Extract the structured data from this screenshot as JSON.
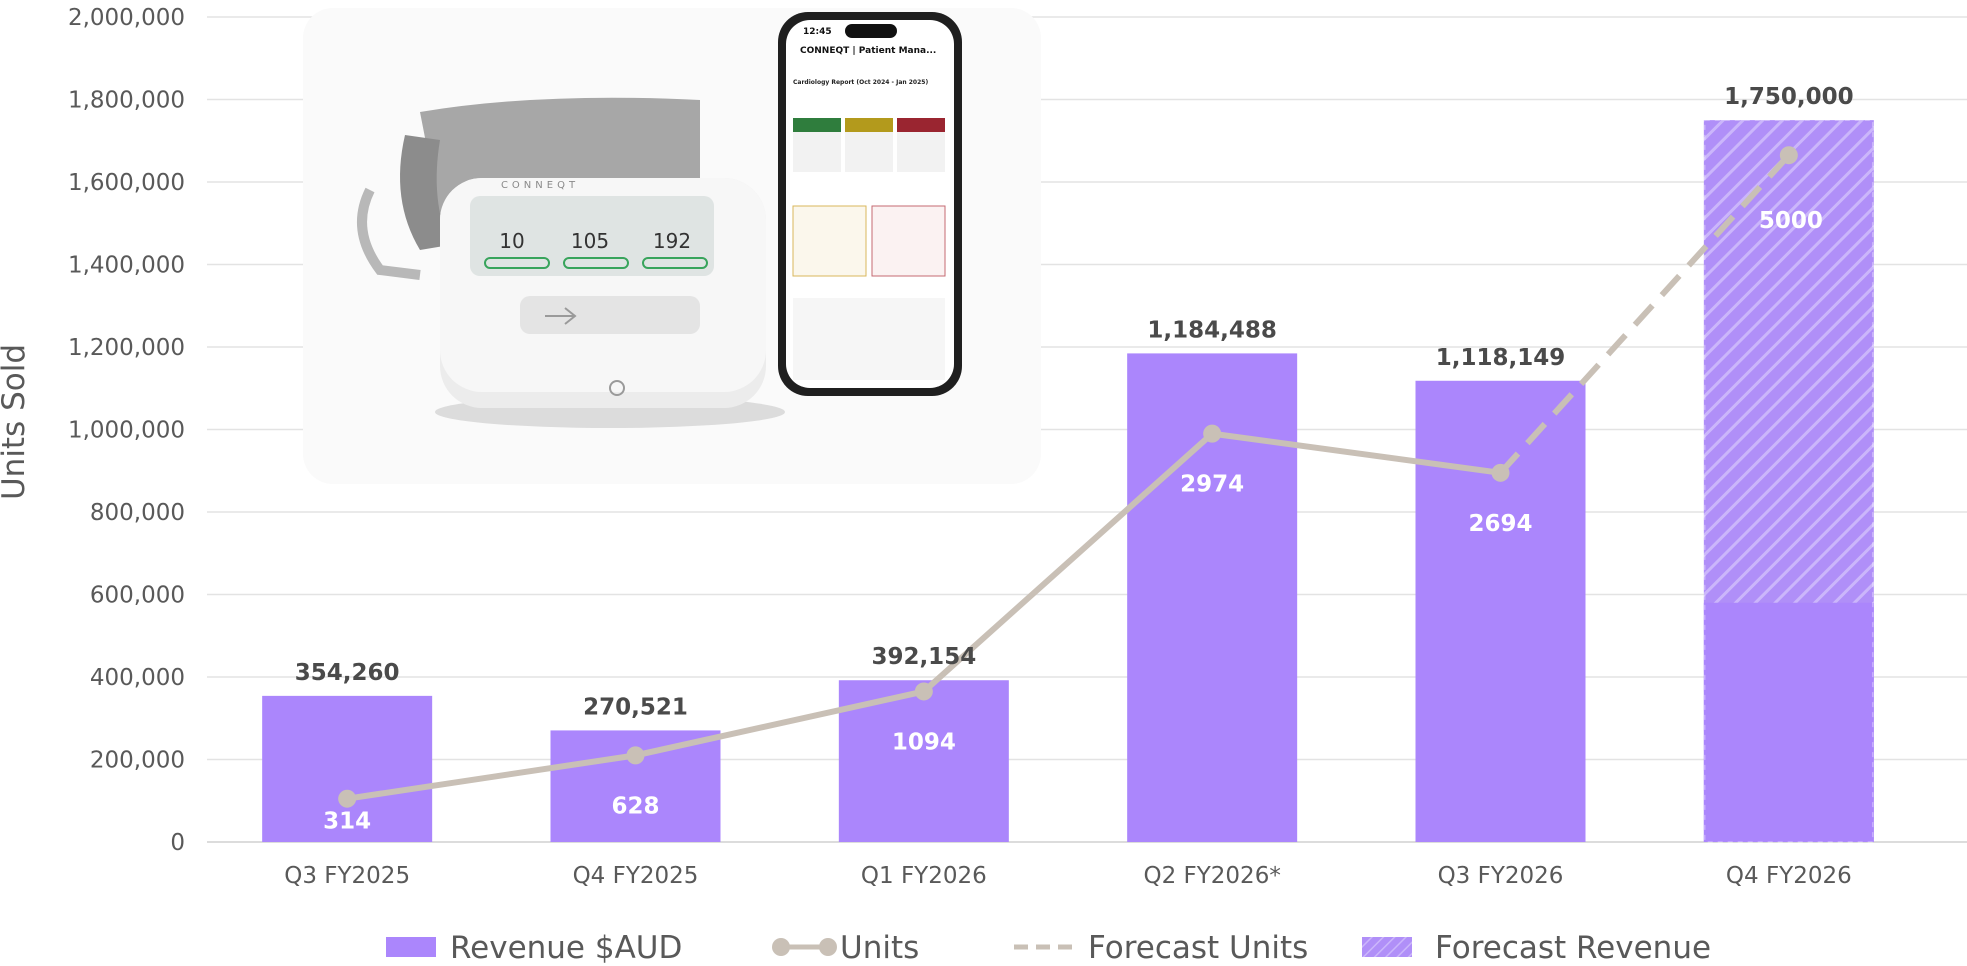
{
  "chart_data": {
    "type": "bar",
    "ylabel": "Units Sold",
    "xlabel": "",
    "ylim": [
      0,
      2000000
    ],
    "yticks": [
      "0",
      "200,000",
      "400,000",
      "600,000",
      "800,000",
      "1,000,000",
      "1,200,000",
      "1,400,000",
      "1,600,000",
      "1,800,000",
      "2,000,000"
    ],
    "categories": [
      "Q3 FY2025",
      "Q4 FY2025",
      "Q1 FY2026",
      "Q2 FY2026*",
      "Q3 FY2026",
      "Q4 FY2026"
    ],
    "grid": true,
    "legend_placement": "bottom",
    "series": [
      {
        "name": "Revenue $AUD",
        "kind": "bar",
        "color": "#ab86fc",
        "values": [
          354260,
          270521,
          392154,
          1184488,
          1118149,
          580000
        ],
        "data_labels": [
          "354,260",
          "270,521",
          "392,154",
          "1,184,488",
          "1,118,149",
          ""
        ]
      },
      {
        "name": "Forecast Revenue",
        "kind": "bar-hatched",
        "color": "#ab86fc",
        "values": [
          null,
          null,
          null,
          null,
          null,
          1750000
        ],
        "data_labels": [
          "",
          "",
          "",
          "",
          "",
          "1,750,000"
        ]
      },
      {
        "name": "Units",
        "kind": "line",
        "color": "#c9c0b6",
        "values": [
          314,
          628,
          1094,
          2974,
          2694,
          null
        ],
        "plotted_y": [
          105000,
          210000,
          365000,
          990000,
          895000,
          null
        ],
        "data_labels": [
          "314",
          "628",
          "1094",
          "2974",
          "2694",
          ""
        ]
      },
      {
        "name": "Forecast Units",
        "kind": "dashed-line",
        "color": "#c9c0b6",
        "values": [
          null,
          null,
          null,
          null,
          2694,
          5000
        ],
        "plotted_y": [
          null,
          null,
          null,
          null,
          895000,
          1665000
        ],
        "data_labels": [
          "",
          "",
          "",
          "",
          "",
          "5000"
        ]
      }
    ]
  },
  "legend": {
    "revenue": "Revenue $AUD",
    "units": "Units",
    "forecast_units": "Forecast Units",
    "forecast_revenue": "Forecast Revenue"
  },
  "image": {
    "description_icon": "blood-pressure-monitor-and-phone-app-photo",
    "app_title": "CONNEQT | Patient Mana...",
    "report_title": "Cardiology Report (Oct 2024 - Jan 2025)",
    "brand": "CONNEQT",
    "time": "12:45",
    "readings": [
      "10",
      "105",
      "192"
    ]
  }
}
